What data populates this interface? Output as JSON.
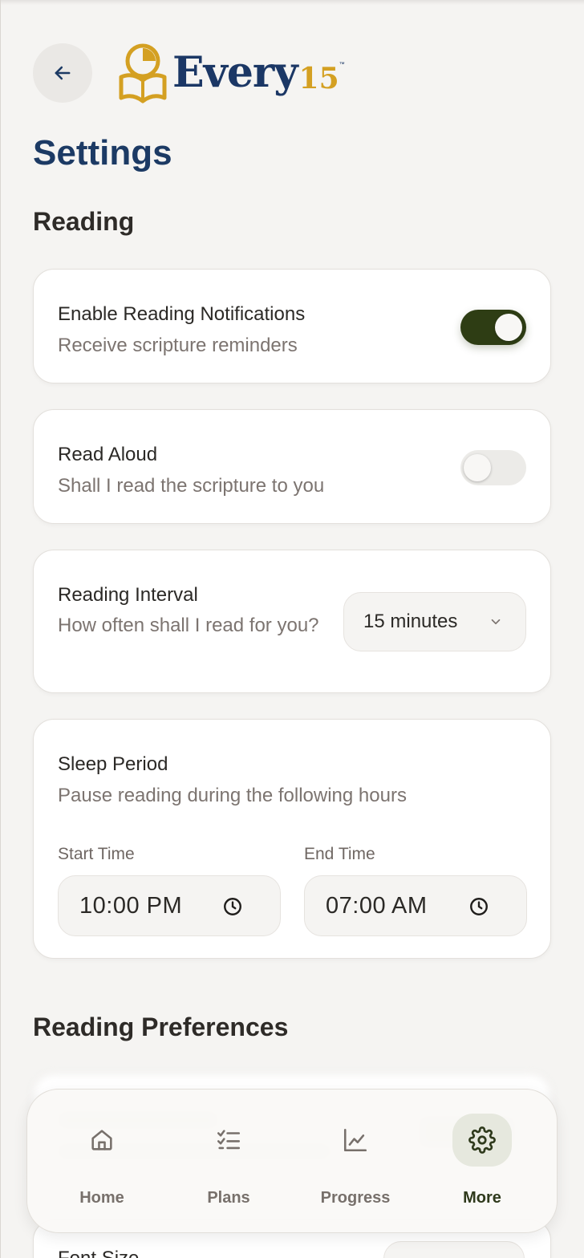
{
  "header": {
    "logo_word": "Every",
    "logo_number": "15",
    "logo_tm": "™"
  },
  "page_title": "Settings",
  "sections": {
    "reading": "Reading",
    "preferences": "Reading Preferences"
  },
  "notifications": {
    "title": "Enable Reading Notifications",
    "subtitle": "Receive scripture reminders",
    "enabled": true
  },
  "read_aloud": {
    "title": "Read Aloud",
    "subtitle": "Shall I read the scripture to you",
    "enabled": false
  },
  "interval": {
    "title": "Reading Interval",
    "subtitle": "How often shall I read for you?",
    "selected": "15 minutes"
  },
  "sleep": {
    "title": "Sleep Period",
    "subtitle": "Pause reading during the following hours",
    "start_label": "Start Time",
    "start_value": "10:00  PM",
    "end_label": "End Time",
    "end_value": "07:00  AM"
  },
  "font_size": {
    "title": "Font Size"
  },
  "nav": {
    "items": [
      {
        "label": "Home",
        "icon": "home-icon"
      },
      {
        "label": "Plans",
        "icon": "checklist-icon"
      },
      {
        "label": "Progress",
        "icon": "chart-icon"
      },
      {
        "label": "More",
        "icon": "gear-icon"
      }
    ],
    "active": "More"
  },
  "colors": {
    "brand_navy": "#1c3a64",
    "brand_gold": "#d4a022",
    "toggle_on": "#2e3d14",
    "background": "#f5f4f2"
  }
}
